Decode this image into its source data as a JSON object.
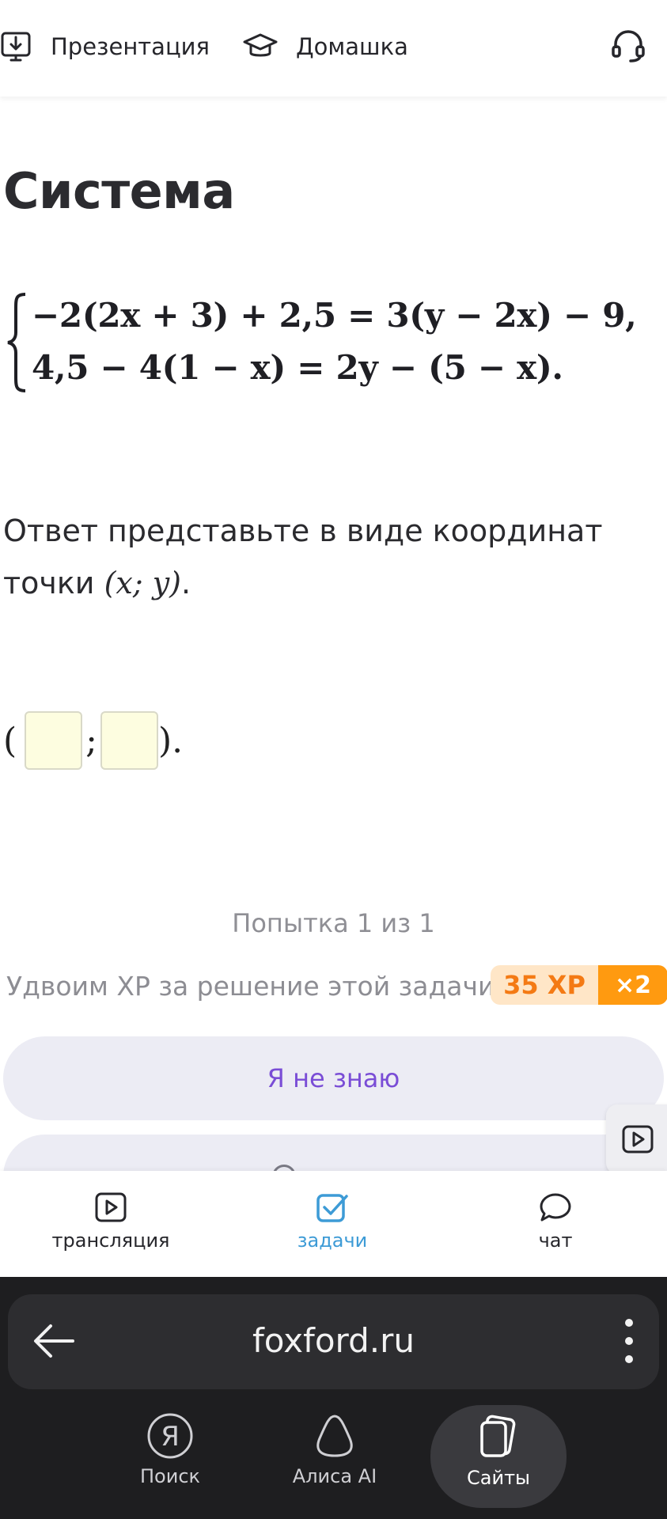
{
  "topbar": {
    "presentation_label": "Презентация",
    "homework_label": "Домашка"
  },
  "task": {
    "title": "Система",
    "equations": [
      "−2(2x + 3) + 2,5 = 3(y − 2x) − 9,",
      "4,5 − 4(1 − x) = 2y − (5 − x)."
    ],
    "question_text": "Ответ представьте в виде координат точки",
    "question_math": "(x; y)",
    "question_end": ".",
    "answer_open": "(",
    "answer_sep": ";",
    "answer_close": ")."
  },
  "attempt": "Попытка 1 из 1",
  "xp": {
    "text": "Удвоим XP за решение этой задачи",
    "amount": "35 XP",
    "multiplier": "×2",
    "colors": {
      "amount_bg": "#ffe6c7",
      "amount_fg": "#f47a14",
      "mult_bg": "#ff9a10"
    }
  },
  "buttons": {
    "dont_know": "Я не знаю"
  },
  "tabs": [
    {
      "label": "трансляция",
      "icon": "play-icon"
    },
    {
      "label": "задачи",
      "icon": "task-check-icon",
      "active": true
    },
    {
      "label": "чат",
      "icon": "chat-bubble-icon"
    }
  ],
  "browser": {
    "url": "foxford.ru",
    "nav": [
      {
        "label": "Поиск",
        "icon": "yandex-search-icon"
      },
      {
        "label": "Алиса AI",
        "icon": "alice-icon"
      },
      {
        "label": "Сайты",
        "icon": "sites-cards-icon",
        "active": true
      }
    ]
  },
  "accent_colors": {
    "tasks_active": "#3d9bd6",
    "dont_know_text": "#7a4dd6"
  }
}
